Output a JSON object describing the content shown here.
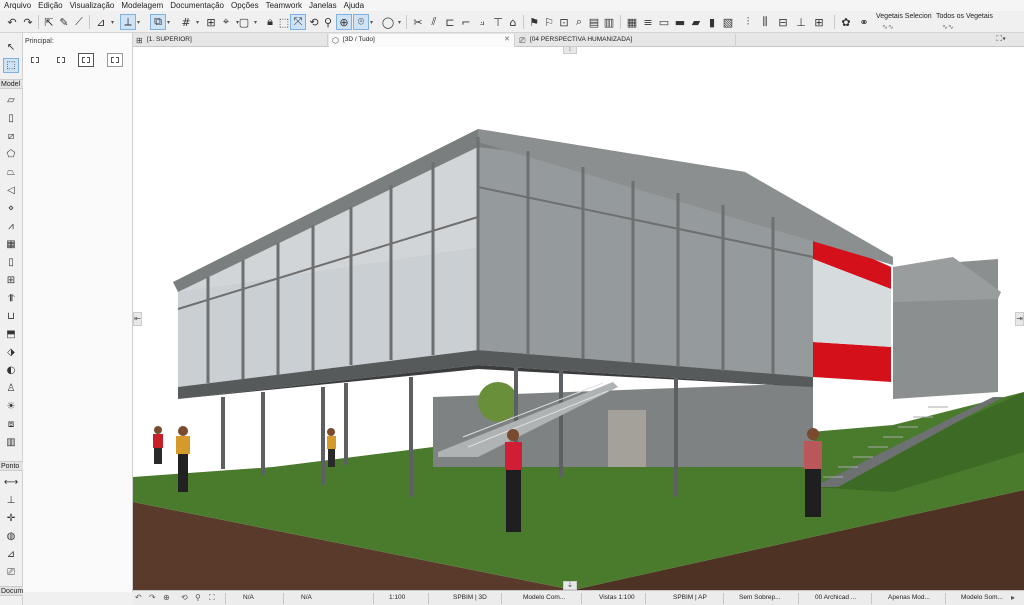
{
  "menu": [
    "Arquivo",
    "Edição",
    "Visualização",
    "Modelagem",
    "Documentação",
    "Opções",
    "Teamwork",
    "Janelas",
    "Ajuda"
  ],
  "toolbar": {
    "veg_selected_label": "Vegetais Selecion",
    "veg_all_label": "Todos os Vegetais"
  },
  "palette": {
    "model_header": "Model",
    "point_header": "Ponto",
    "doc_header": "Docum"
  },
  "infobox": {
    "principal_label": "Principal:"
  },
  "tabs": [
    {
      "label": "[1. SUPERIOR]"
    },
    {
      "label": "[3D / Tudo]"
    },
    {
      "label": "[04 PERSPECTIVA HUMANIZADA]"
    }
  ],
  "status": {
    "na1": "N/A",
    "na2": "N/A",
    "scale": "1:100",
    "pen_set": "SPBIM | 3D",
    "model_view": "Modelo Com...",
    "views": "Vistas 1:100",
    "layer_combo": "SPBIM | AP",
    "override": "Sem Sobrep...",
    "renovation": "00 Archicad ...",
    "filter": "Apenas Mod...",
    "display": "Modelo Som..."
  },
  "colors": {
    "grass": "#4a7a2c",
    "soil": "#5a3a2a",
    "concrete": "#8a8d8e",
    "glass": "#c9cfd2",
    "accent_red": "#d4101a",
    "active_blue": "#cfe3f7"
  }
}
